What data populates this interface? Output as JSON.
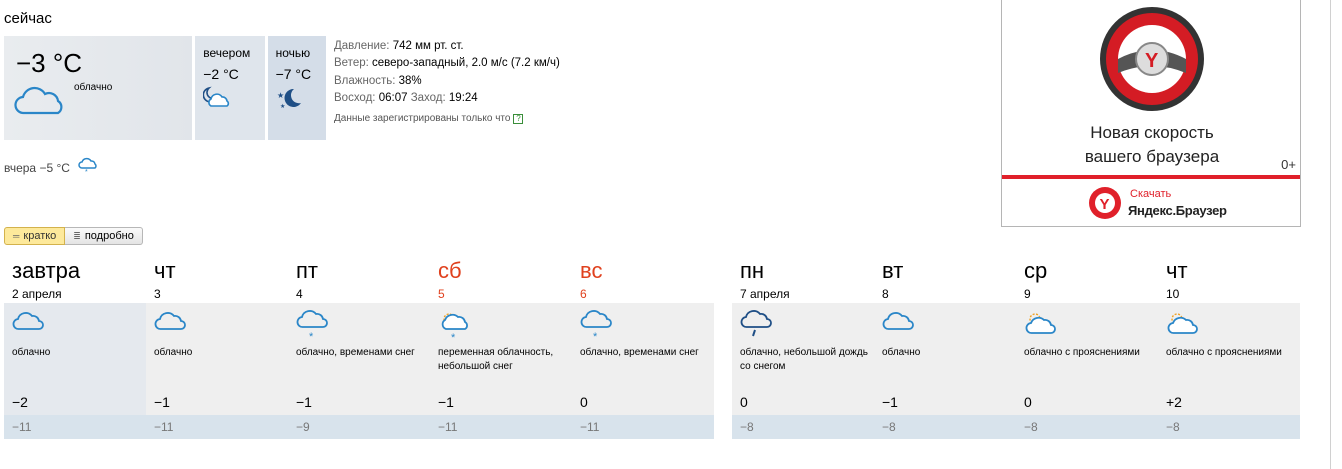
{
  "now": {
    "label": "сейчас",
    "temp": "−3 °C",
    "condition": "облачно",
    "condition_icon": "cloud-icon",
    "parts": [
      {
        "name": "вечером",
        "temp": "−2 °C",
        "icon": "cloud-moon-icon"
      },
      {
        "name": "ночью",
        "temp": "−7 °C",
        "icon": "moon-stars-icon"
      }
    ]
  },
  "details": {
    "pressure_label": "Давление:",
    "pressure_value": "742 мм рт. ст.",
    "wind_label": "Ветер:",
    "wind_value": "северо-западный, 2.0 м/с (7.2 км/ч)",
    "humidity_label": "Влажность:",
    "humidity_value": "38%",
    "sunrise_label": "Восход:",
    "sunrise_value": "06:07",
    "sunset_label": "Заход:",
    "sunset_value": "19:24",
    "reg_note": "Данные зарегистрированы только что",
    "help_mark": "?"
  },
  "yesterday": {
    "text": "вчера −5 °C",
    "icon": "snow-cloud-icon"
  },
  "view_toggle": {
    "brief": "кратко",
    "detailed": "подробно",
    "active": "brief"
  },
  "forecast": [
    {
      "name": "завтра",
      "date": "2 апреля",
      "icon": "cloud-icon",
      "condition": "облачно",
      "day_temp": "−2",
      "night_temp": "−11",
      "weekend": false
    },
    {
      "name": "чт",
      "date": "3",
      "icon": "cloud-icon",
      "condition": "облачно",
      "day_temp": "−1",
      "night_temp": "−11",
      "weekend": false
    },
    {
      "name": "пт",
      "date": "4",
      "icon": "snow-cloud-icon",
      "condition": "облачно, временами снег",
      "day_temp": "−1",
      "night_temp": "−9",
      "weekend": false
    },
    {
      "name": "сб",
      "date": "5",
      "icon": "sun-snow-cloud-icon",
      "condition": "переменная облачность, небольшой снег",
      "day_temp": "−1",
      "night_temp": "−11",
      "weekend": true
    },
    {
      "name": "вс",
      "date": "6",
      "icon": "snow-cloud-icon",
      "condition": "облачно, временами снег",
      "day_temp": "0",
      "night_temp": "−11",
      "weekend": true
    },
    {
      "name": "пн",
      "date": "7 апреля",
      "icon": "rain-snow-cloud-icon",
      "condition": "облачно, небольшой дождь со снегом",
      "day_temp": "0",
      "night_temp": "−8",
      "weekend": false
    },
    {
      "name": "вт",
      "date": "8",
      "icon": "cloud-icon",
      "condition": "облачно",
      "day_temp": "−1",
      "night_temp": "−8",
      "weekend": false
    },
    {
      "name": "ср",
      "date": "9",
      "icon": "sun-cloud-icon",
      "condition": "облачно с прояснениями",
      "day_temp": "0",
      "night_temp": "−8",
      "weekend": false
    },
    {
      "name": "чт",
      "date": "10",
      "icon": "sun-cloud-icon",
      "condition": "облачно с прояснениями",
      "day_temp": "+2",
      "night_temp": "−8",
      "weekend": false
    }
  ],
  "ad": {
    "line1": "Новая скорость",
    "line2": "вашего браузера",
    "age": "0+",
    "download": "Скачать",
    "brand": "Яндекс.Браузер",
    "accent": "#e0202a"
  },
  "colors": {
    "cloud": "#2a86c8",
    "weekend": "#e0411e",
    "night_band": "#d8e3ec"
  }
}
